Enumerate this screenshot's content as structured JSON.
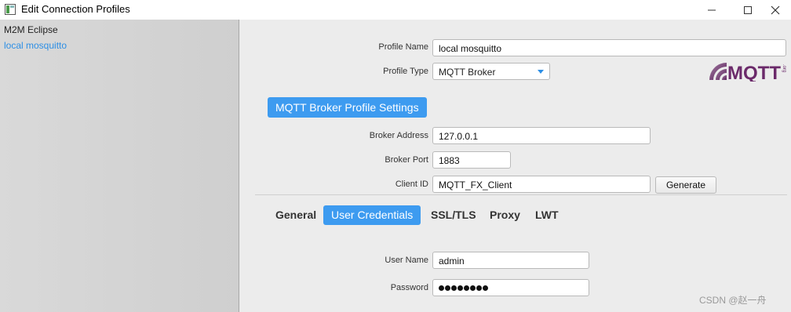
{
  "window": {
    "title": "Edit Connection Profiles",
    "controls": [
      "minimize",
      "maximize",
      "close"
    ]
  },
  "sidebar": {
    "items": [
      {
        "label": "M2M Eclipse",
        "selected": false
      },
      {
        "label": "local mosquitto",
        "selected": true
      }
    ]
  },
  "profile": {
    "name_label": "Profile Name",
    "name_value": "local mosquitto",
    "type_label": "Profile Type",
    "type_value": "MQTT Broker"
  },
  "logo": {
    "text": "MQTT",
    "small_text": ".org"
  },
  "broker": {
    "section_title": "MQTT Broker Profile Settings",
    "address_label": "Broker Address",
    "address_value": "127.0.0.1",
    "port_label": "Broker Port",
    "port_value": "1883",
    "client_id_label": "Client ID",
    "client_id_value": "MQTT_FX_Client",
    "generate_label": "Generate"
  },
  "tabs": [
    {
      "label": "General",
      "active": false
    },
    {
      "label": "User Credentials",
      "active": true
    },
    {
      "label": "SSL/TLS",
      "active": false
    },
    {
      "label": "Proxy",
      "active": false
    },
    {
      "label": "LWT",
      "active": false
    }
  ],
  "credentials": {
    "user_label": "User Name",
    "user_value": "admin",
    "password_label": "Password",
    "password_masked_length": 8
  },
  "watermark": "CSDN @赵一舟",
  "colors": {
    "accent": "#3d9bf0",
    "selected_text": "#2d8fe5",
    "logo_purple": "#6b2a6a"
  }
}
